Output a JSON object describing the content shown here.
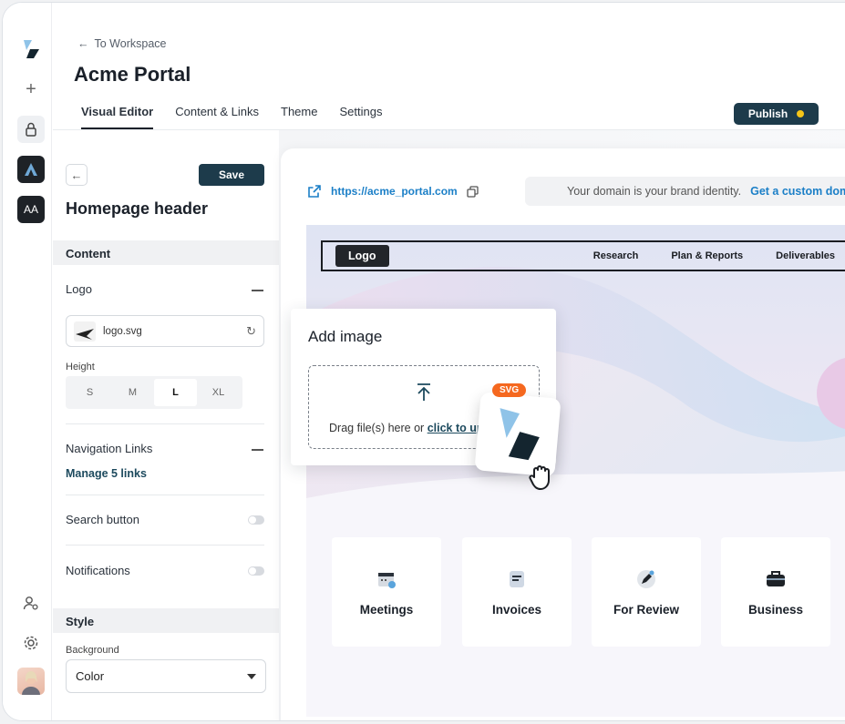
{
  "workspace_back": "To Workspace",
  "app_title": "Acme Portal",
  "tabs": [
    {
      "label": "Visual Editor",
      "active": true
    },
    {
      "label": "Content & Links"
    },
    {
      "label": "Theme"
    },
    {
      "label": "Settings"
    }
  ],
  "publish_label": "Publish",
  "rail": {
    "aa_label": "AA"
  },
  "panel": {
    "save_label": "Save",
    "title": "Homepage header",
    "content_section": "Content",
    "logo_label": "Logo",
    "logo_file": "logo.svg",
    "height_label": "Height",
    "sizes": [
      "S",
      "M",
      "L",
      "XL"
    ],
    "selected_size": "L",
    "nav_links_label": "Navigation Links",
    "manage_links": "Manage 5 links",
    "search_button_label": "Search button",
    "notifications_label": "Notifications",
    "style_section": "Style",
    "background_label": "Background",
    "background_value": "Color"
  },
  "canvas": {
    "url": "https://acme_portal.com",
    "domain_hint": "Your domain is your brand identity.",
    "domain_cta": "Get a custom domain",
    "site_logo": "Logo",
    "site_links": [
      "Research",
      "Plan & Reports",
      "Deliverables"
    ],
    "cards": [
      "Meetings",
      "Invoices",
      "For Review",
      "Business"
    ]
  },
  "popup": {
    "title": "Add image",
    "drop_text": "Drag file(s) here or ",
    "drop_link": "click to upload",
    "badge": "SVG"
  },
  "colors": {
    "accent": "#1d3b4b",
    "link": "#1b7fc7",
    "status_dot": "#f5c518",
    "badge": "#f5681f"
  }
}
